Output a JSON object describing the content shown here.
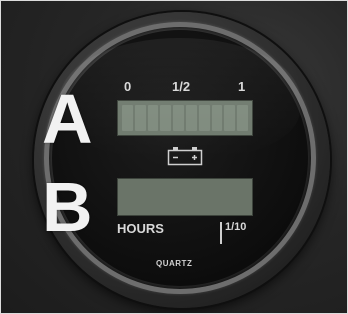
{
  "gauge": {
    "scale_labels": [
      "0",
      "1/2",
      "1"
    ],
    "hours_label": "HOURS",
    "tenth_label": "1/10",
    "brand": "QUARTZ",
    "battery_segments_total": 10
  },
  "overlay": {
    "letter_a": "A",
    "letter_b": "B"
  },
  "colors": {
    "lcd": "#6f7a6e",
    "face": "#0d0d0d",
    "bezel": "#6d6d6d",
    "label": "#d8d8d8",
    "overlay_letter": "#f2f2f2"
  },
  "icons": [
    "battery-icon"
  ]
}
